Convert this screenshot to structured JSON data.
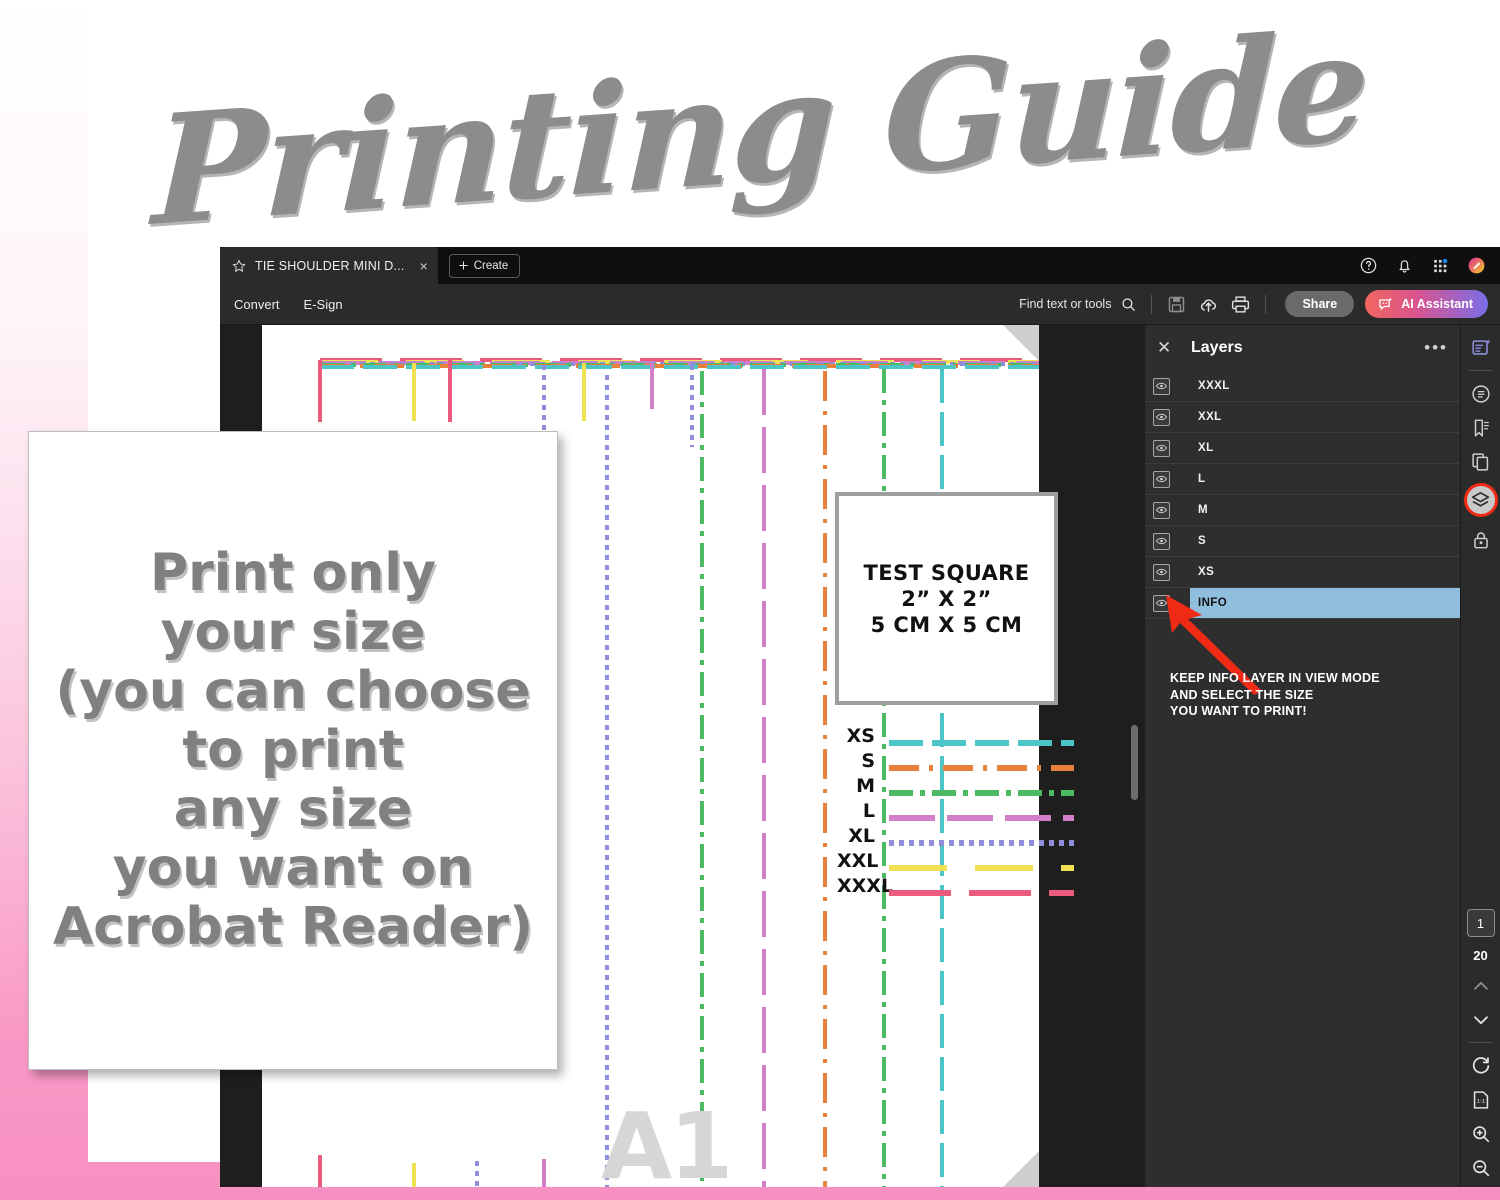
{
  "heading": {
    "text": "Printing Guide"
  },
  "callout": {
    "lines": [
      "Print only",
      "your size",
      "(you can choose",
      "to print",
      "any size",
      "you want on",
      "Acrobat Reader)"
    ]
  },
  "app": {
    "tab": {
      "title": "TIE SHOULDER MINI D...",
      "close_label": "×",
      "star_icon": "star-icon"
    },
    "create_button": {
      "label": "Create",
      "icon": "plus-icon"
    },
    "tabstrip_icons": [
      "help-icon",
      "bell-icon",
      "apps-grid-icon",
      "account-avatar-icon"
    ],
    "toolbar": {
      "menus": [
        "Convert",
        "E-Sign"
      ],
      "find_placeholder": "Find text or tools",
      "find_icon": "search-icon",
      "icons": [
        "save-icon",
        "upload-cloud-icon",
        "print-icon"
      ],
      "share_label": "Share",
      "ai_label": "AI Assistant",
      "ai_icon": "ai-sparkle-chat-icon",
      "share_color": "#6a6a6a",
      "ai_gradient_start": "#f2675f",
      "ai_gradient_end": "#7b6ee8"
    }
  },
  "layers_panel": {
    "title": "Layers",
    "close_icon": "close-icon",
    "more_icon": "overflow-menu-icon",
    "selected_color": "#92bedd",
    "rows": [
      {
        "name": "XXXL",
        "selected": false
      },
      {
        "name": "XXL",
        "selected": false
      },
      {
        "name": "XL",
        "selected": false
      },
      {
        "name": "L",
        "selected": false
      },
      {
        "name": "M",
        "selected": false
      },
      {
        "name": "S",
        "selected": false
      },
      {
        "name": "XS",
        "selected": false
      },
      {
        "name": "INFO",
        "selected": true
      }
    ],
    "note_lines": [
      "KEEP INFO LAYER IN VIEW MODE",
      "AND SELECT THE SIZE",
      "YOU WANT TO PRINT!"
    ],
    "arrow_color": "#ef2b16"
  },
  "right_rail": {
    "icons": [
      "edit-pdf-icon",
      "comment-icon",
      "bookmark-icon",
      "organize-pages-icon",
      "layers-icon",
      "protect-lock-icon"
    ],
    "highlighted_icon": "layers-icon",
    "highlight_color": "#ef2b16",
    "page_current": "1",
    "page_total": "20",
    "nav_icons": [
      "chevron-up-icon",
      "chevron-down-icon"
    ],
    "tool_icons": [
      "rotate-icon",
      "fit-page-icon",
      "zoom-in-icon",
      "zoom-out-icon"
    ]
  },
  "document": {
    "watermark": "A1",
    "test_square": {
      "lines": [
        "TEST SQUARE",
        "2” X 2”",
        "5 CM X 5 CM"
      ],
      "border_color": "#9f9f9f"
    },
    "size_legend": [
      {
        "label": "XS",
        "color": "#4cc5c8",
        "dash": "34 9"
      },
      {
        "label": "S",
        "color": "#e8803a",
        "dash": "30 10 4 10"
      },
      {
        "label": "M",
        "color": "#4cb963",
        "dash": "24 7 5 7"
      },
      {
        "label": "L",
        "color": "#d17fc6",
        "dash": "46 12"
      },
      {
        "label": "XL",
        "color": "#8e8edb",
        "dash": "5 5"
      },
      {
        "label": "XXL",
        "color": "#efe152",
        "dash": "58 28"
      },
      {
        "label": "XXXL",
        "color": "#ec5b7e",
        "dash": "62 18"
      }
    ]
  },
  "background": {
    "pink": "#f790c2",
    "sheet": "#ffffff"
  }
}
